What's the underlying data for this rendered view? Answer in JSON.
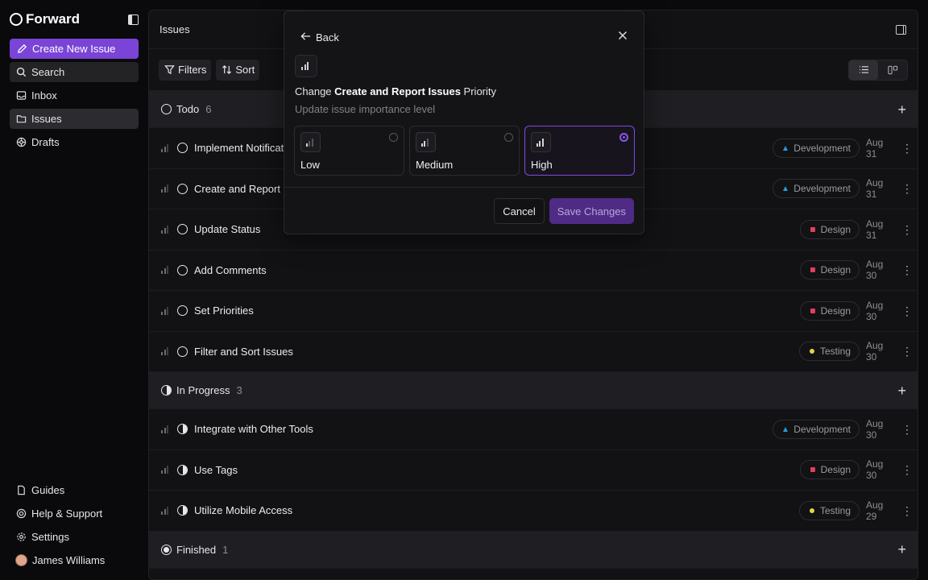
{
  "brand": {
    "name": "Forward"
  },
  "sidebar": {
    "create_label": "Create New Issue",
    "items": [
      {
        "label": "Search"
      },
      {
        "label": "Inbox"
      },
      {
        "label": "Issues"
      },
      {
        "label": "Drafts"
      }
    ],
    "bottom": [
      {
        "label": "Guides"
      },
      {
        "label": "Help & Support"
      },
      {
        "label": "Settings"
      },
      {
        "label": "James Williams"
      }
    ]
  },
  "main": {
    "title": "Issues",
    "filters_label": "Filters",
    "sort_label": "Sort",
    "groups": [
      {
        "name": "Todo",
        "count": "6",
        "rows": [
          {
            "title": "Implement Notificat",
            "tag": "Development",
            "date": "Aug 31"
          },
          {
            "title": "Create and Report I",
            "tag": "Development",
            "date": "Aug 31"
          },
          {
            "title": "Update Status",
            "tag": "Design",
            "date": "Aug 31"
          },
          {
            "title": "Add Comments",
            "tag": "Design",
            "date": "Aug 30"
          },
          {
            "title": "Set Priorities",
            "tag": "Design",
            "date": "Aug 30"
          },
          {
            "title": "Filter and Sort Issues",
            "tag": "Testing",
            "date": "Aug 30"
          }
        ]
      },
      {
        "name": "In Progress",
        "count": "3",
        "rows": [
          {
            "title": "Integrate with Other Tools",
            "tag": "Development",
            "date": "Aug 30"
          },
          {
            "title": "Use Tags",
            "tag": "Design",
            "date": "Aug 30"
          },
          {
            "title": "Utilize Mobile Access",
            "tag": "Testing",
            "date": "Aug 29"
          }
        ]
      },
      {
        "name": "Finished",
        "count": "1"
      }
    ]
  },
  "modal": {
    "back_label": "Back",
    "title_prefix": "Change ",
    "title_issue": "Create and Report Issues",
    "title_suffix": " Priority",
    "subtitle": "Update issue importance level",
    "options": [
      {
        "label": "Low",
        "selected": false
      },
      {
        "label": "Medium",
        "selected": false
      },
      {
        "label": "High",
        "selected": true
      }
    ],
    "cancel_label": "Cancel",
    "save_label": "Save Changes"
  },
  "colors": {
    "accent": "#7a44d6",
    "development": "#2a9ad8",
    "design": "#e0405e",
    "testing": "#e6d34a"
  }
}
